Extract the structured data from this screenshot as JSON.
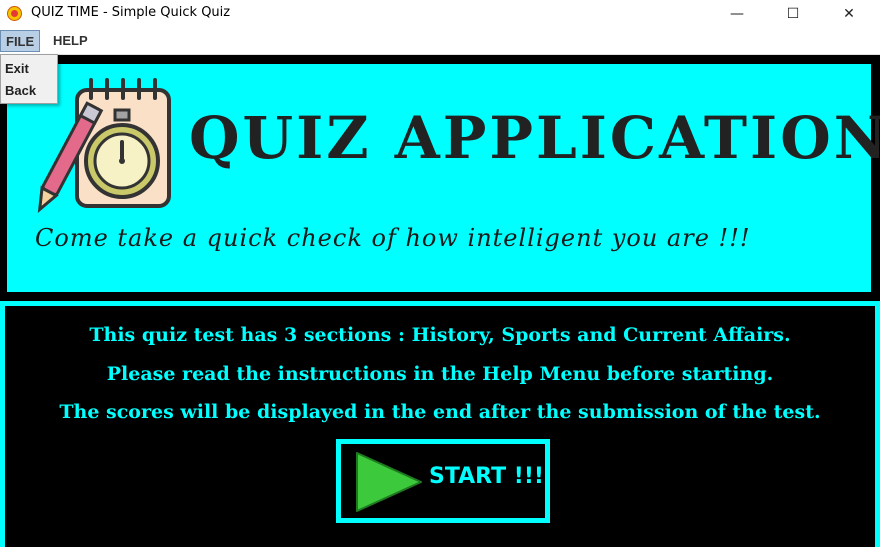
{
  "window": {
    "title": "QUIZ TIME - Simple Quick Quiz",
    "minimize": "—",
    "maximize": "☐",
    "close": "✕"
  },
  "menubar": {
    "file": "FILE",
    "help": "HELP"
  },
  "file_menu": {
    "items": [
      "Exit",
      "Back"
    ]
  },
  "banner": {
    "title": "QUIZ APPLICATION",
    "tagline": "Come take a quick check of how intelligent you are !!!"
  },
  "info": {
    "line1": "This quiz test has 3 sections : History, Sports and Current Affairs.",
    "line2": "Please read the instructions in the Help Menu before starting.",
    "line3": "The scores will be displayed in the end after the submission of the test."
  },
  "start_button": {
    "label": "START !!!"
  },
  "colors": {
    "accent": "#00ffff",
    "background": "#000000",
    "play_green": "#3cc93c"
  }
}
